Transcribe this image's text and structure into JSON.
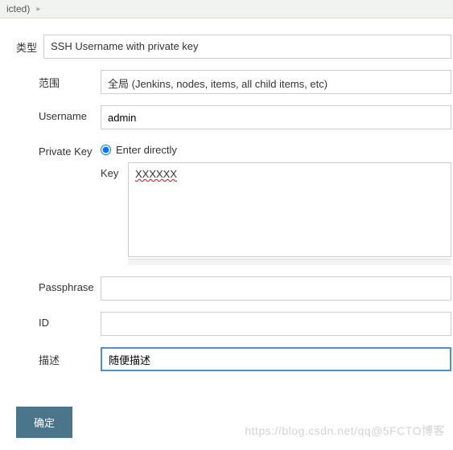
{
  "breadcrumb": {
    "item": "icted)"
  },
  "form": {
    "type": {
      "label": "类型",
      "value": "SSH Username with private key"
    },
    "scope": {
      "label": "范围",
      "value": "全局 (Jenkins, nodes, items, all child items, etc)"
    },
    "username": {
      "label": "Username",
      "value": "admin"
    },
    "private_key": {
      "label": "Private Key",
      "radio_label": "Enter directly",
      "key_label": "Key",
      "key_value": "XXXXXX"
    },
    "passphrase": {
      "label": "Passphrase",
      "value": ""
    },
    "id": {
      "label": "ID",
      "value": ""
    },
    "description": {
      "label": "描述",
      "value": "随便描述"
    },
    "submit": {
      "label": "确定"
    }
  },
  "watermark": "https://blog.csdn.net/qq@5FCTO博客"
}
